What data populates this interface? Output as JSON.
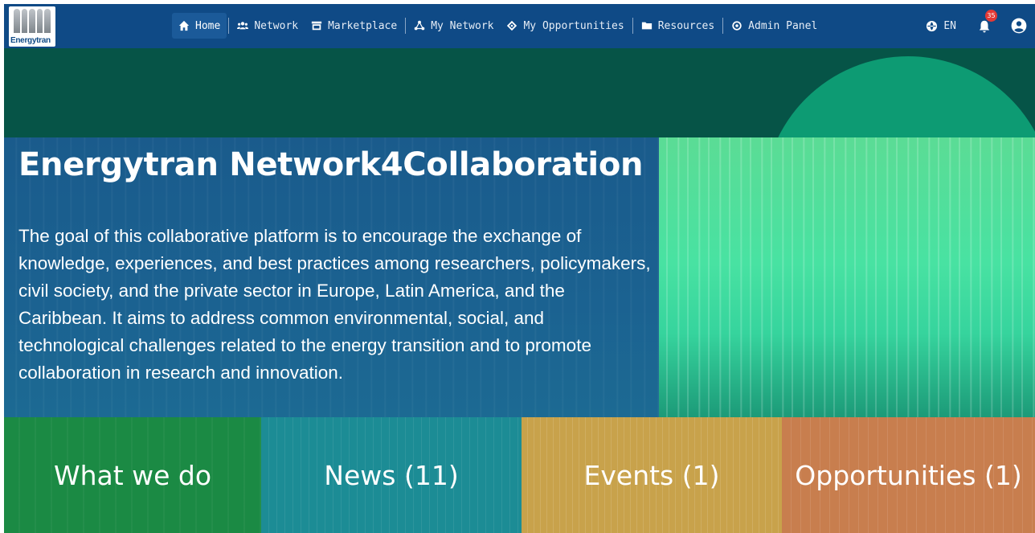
{
  "brand": {
    "logo_text": "Energytran"
  },
  "nav": {
    "items": [
      {
        "label": "Home",
        "icon": "home-icon"
      },
      {
        "label": "Network",
        "icon": "users-icon"
      },
      {
        "label": "Marketplace",
        "icon": "storefront-icon"
      },
      {
        "label": "My Network",
        "icon": "network-icon"
      },
      {
        "label": "My Opportunities",
        "icon": "tag-icon"
      },
      {
        "label": "Resources",
        "icon": "folder-icon"
      },
      {
        "label": "Admin Panel",
        "icon": "admin-gear-icon"
      }
    ],
    "language": "EN",
    "notifications_count": "35"
  },
  "hero": {
    "title": "Energytran Network4Collaboration",
    "description": "The goal of this collaborative platform is to encourage the exchange of knowledge, experiences, and best practices among researchers, policymakers, civil society, and the private sector in Europe, Latin America, and the Caribbean. It aims to address common environmental, social, and technological challenges related to the energy transition and to promote collaboration in research and innovation."
  },
  "tiles": [
    {
      "label": "What we do",
      "color": "#1b8a44"
    },
    {
      "label": "News (11)",
      "color": "#1c8c95"
    },
    {
      "label": "Events (1)",
      "color": "#c8a24b"
    },
    {
      "label": "Opportunities (1)",
      "color": "#c87e4e"
    }
  ],
  "colors": {
    "navbar": "#0f4a86",
    "hero_band": "#065447",
    "hero_panel": "#1a5b8c",
    "hero_right": "#48e2a2"
  }
}
